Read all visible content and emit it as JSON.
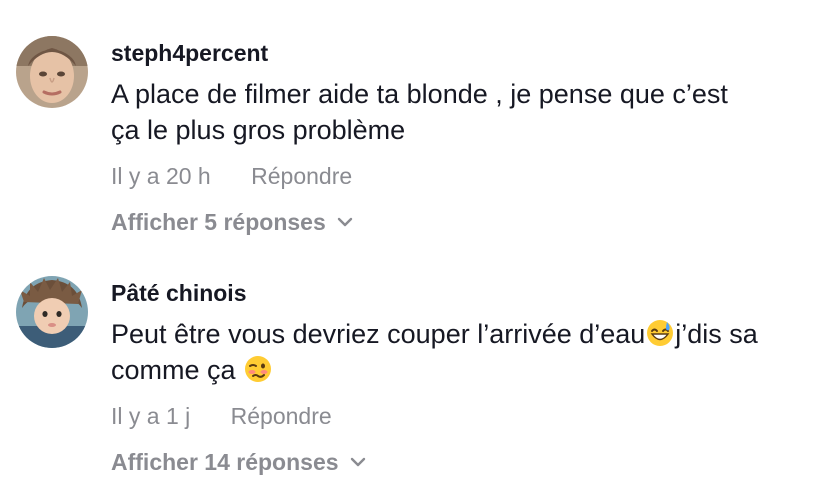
{
  "comments": [
    {
      "username": "steph4percent",
      "text": "A place de filmer aide ta blonde , je pense que c’est ça le plus gros problème",
      "time": "Il y a 20 h",
      "reply_label": "Répondre",
      "view_replies_label": "Afficher 5 réponses",
      "avatar": "avatar-woman-photo"
    },
    {
      "username": "Pâté chinois",
      "text_part1": "Peut être vous devriez couper l’arrivée d’eau",
      "emoji1": "grinning-sweat-emoji",
      "text_part2": "j’dis sa comme ça",
      "emoji2": "woozy-face-emoji",
      "time": "Il y a 1 j",
      "reply_label": "Répondre",
      "view_replies_label": "Afficher 14 réponses",
      "avatar": "avatar-baby-photo"
    }
  ],
  "colors": {
    "text_primary": "#161823",
    "text_secondary": "#8a8b91"
  }
}
